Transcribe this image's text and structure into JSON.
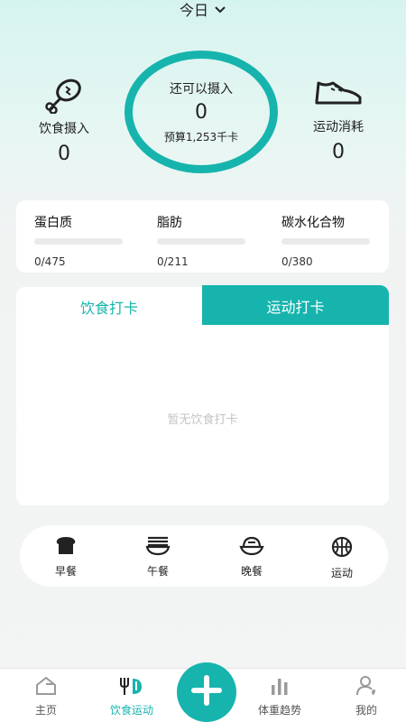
{
  "header": {
    "date_label": "今日",
    "chevron_icon": "chevron-down-icon"
  },
  "summary": {
    "intake": {
      "label": "饮食摄入",
      "value": "0",
      "icon": "drumstick-icon"
    },
    "remaining": {
      "label": "还可以摄入",
      "value": "0",
      "budget": "预算1,253千卡"
    },
    "burn": {
      "label": "运动消耗",
      "value": "0",
      "icon": "sneaker-icon"
    }
  },
  "nutrients": [
    {
      "name": "蛋白质",
      "value": "0/475"
    },
    {
      "name": "脂肪",
      "value": "0/211"
    },
    {
      "name": "碳水化合物",
      "value": "0/380"
    }
  ],
  "tabs": {
    "diet": "饮食打卡",
    "exercise": "运动打卡"
  },
  "empty_text": "暂无饮食打卡",
  "quick_add": [
    {
      "label": "早餐",
      "icon": "bread-icon"
    },
    {
      "label": "午餐",
      "icon": "noodle-bowl-icon"
    },
    {
      "label": "晚餐",
      "icon": "rice-bowl-icon"
    },
    {
      "label": "运动",
      "icon": "basketball-icon"
    }
  ],
  "nav": [
    {
      "label": "主页",
      "icon": "home-icon"
    },
    {
      "label": "饮食运动",
      "icon": "fork-knife-icon"
    },
    {
      "label": "体重趋势",
      "icon": "bar-chart-icon"
    },
    {
      "label": "我的",
      "icon": "user-icon"
    }
  ],
  "colors": {
    "accent": "#16b4ad",
    "active_nav": "#16b4ad",
    "inactive_nav": "#9a9a9a"
  },
  "fab_icon": "plus-icon"
}
